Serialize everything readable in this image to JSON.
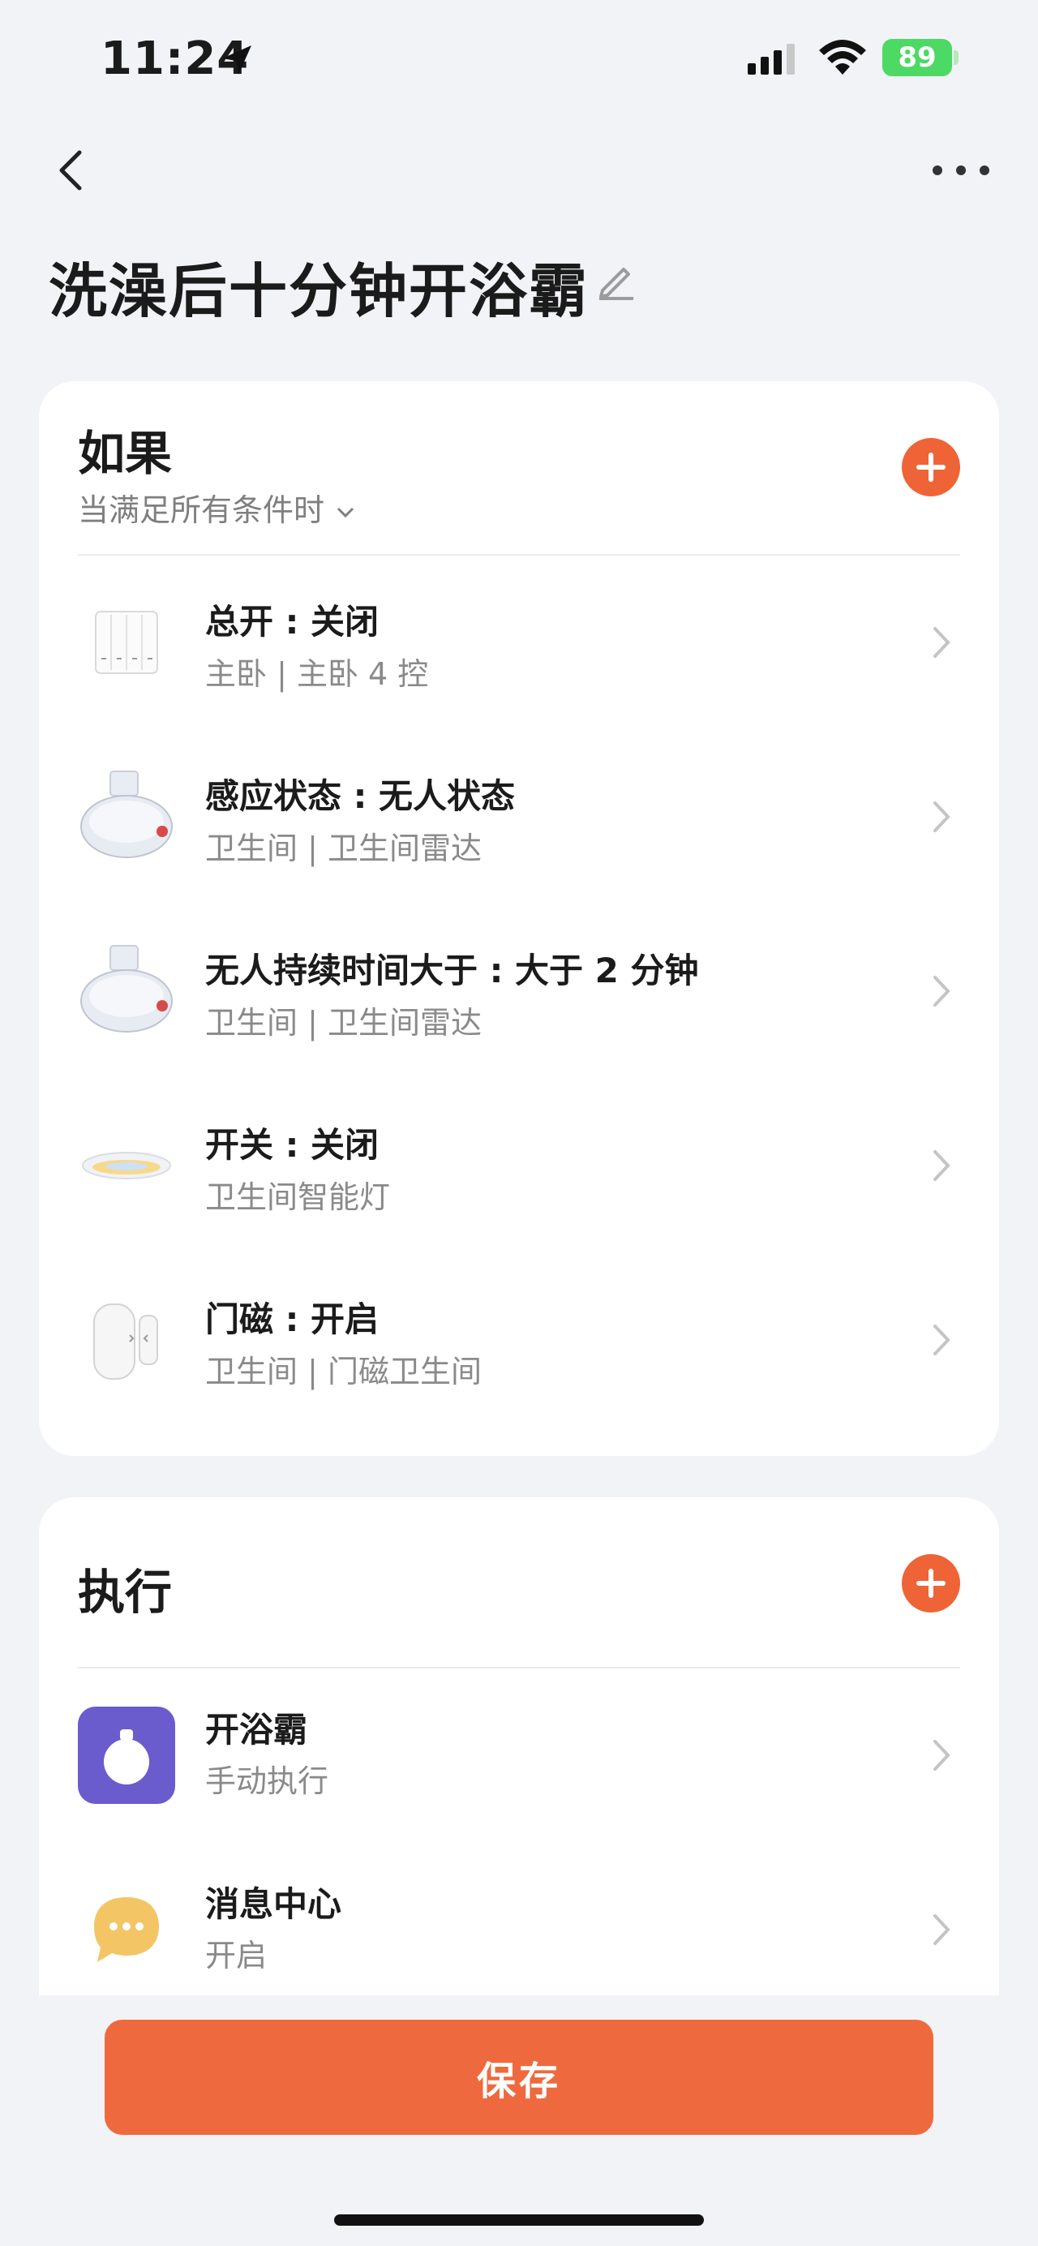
{
  "status": {
    "time": "11:24",
    "battery": "89"
  },
  "title": "洗澡后十分钟开浴霸",
  "conditions": {
    "heading": "如果",
    "mode": "当满足所有条件时",
    "items": [
      {
        "title": "总开 : 关闭",
        "sub": "主卧 | 主卧 4 控",
        "icon": "switch-panel-icon"
      },
      {
        "title": "感应状态 : 无人状态",
        "sub": "卫生间 | 卫生间雷达",
        "icon": "radar-sensor-icon"
      },
      {
        "title": "无人持续时间大于 : 大于 2 分钟",
        "sub": "卫生间 | 卫生间雷达",
        "icon": "radar-sensor-icon"
      },
      {
        "title": "开关 : 关闭",
        "sub": "卫生间智能灯",
        "icon": "smart-light-icon"
      },
      {
        "title": "门磁 : 开启",
        "sub": "卫生间 | 门磁卫生间",
        "icon": "door-sensor-icon"
      }
    ]
  },
  "actions": {
    "heading": "执行",
    "items": [
      {
        "title": "开浴霸",
        "sub": "手动执行",
        "icon": "manual-scene-icon",
        "icon_color": "#6a5ccc"
      },
      {
        "title": "消息中心",
        "sub": "开启",
        "icon": "message-bubble-icon",
        "icon_color": "#f3c565"
      }
    ]
  },
  "save_label": "保存",
  "colors": {
    "accent": "#ee6436",
    "background": "#f2f3f7"
  }
}
